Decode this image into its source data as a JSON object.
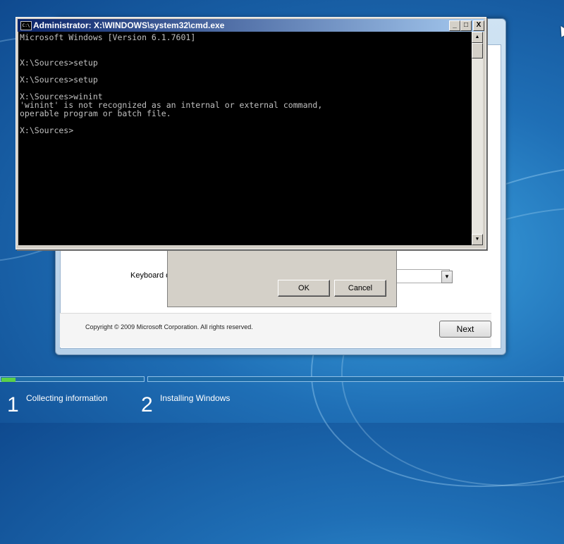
{
  "cmd": {
    "title": "Administrator: X:\\WINDOWS\\system32\\cmd.exe",
    "icon": "C:\\",
    "controls": {
      "minimize": "_",
      "maximize": "□",
      "close": "X"
    },
    "console_text": "Microsoft Windows [Version 6.1.7601]\n\n\nX:\\Sources>setup\n\nX:\\Sources>setup\n\nX:\\Sources>winint\n'winint' is not recognized as an internal or external command,\noperable program or batch file.\n\nX:\\Sources>"
  },
  "setup": {
    "keyboard_label": "Keyboard o",
    "copyright": "Copyright © 2009 Microsoft Corporation. All rights reserved.",
    "next_label": "Next"
  },
  "dialog": {
    "ok_label": "OK",
    "cancel_label": "Cancel"
  },
  "steps": [
    {
      "number": "1",
      "label": "Collecting information"
    },
    {
      "number": "2",
      "label": "Installing Windows"
    }
  ],
  "progress": {
    "step1_fill_fraction": 0.1
  }
}
